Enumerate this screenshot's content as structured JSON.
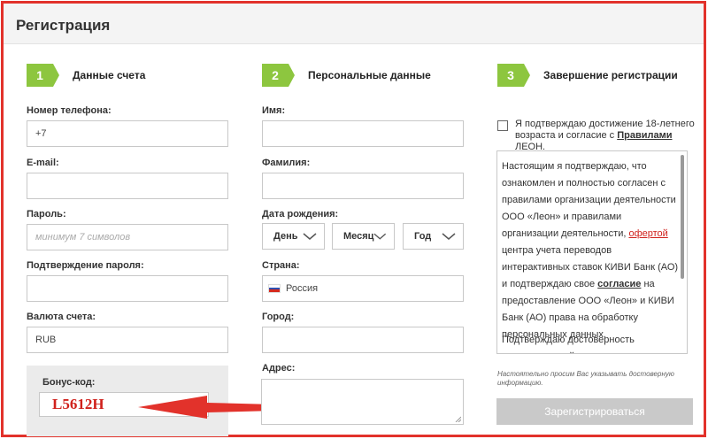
{
  "header": {
    "title": "Регистрация"
  },
  "steps": [
    {
      "num": "1",
      "title": "Данные счета"
    },
    {
      "num": "2",
      "title": "Персональные данные"
    },
    {
      "num": "3",
      "title": "Завершение регистрации"
    }
  ],
  "account": {
    "phone_label": "Номер телефона:",
    "phone_value": "+7",
    "email_label": "E-mail:",
    "email_value": "",
    "password_label": "Пароль:",
    "password_placeholder": "минимум 7 символов",
    "confirm_label": "Подтверждение пароля:",
    "confirm_value": "",
    "currency_label": "Валюта счета:",
    "currency_value": "RUB",
    "bonus_label": "Бонус-код:",
    "bonus_value": "L5612H"
  },
  "personal": {
    "name_label": "Имя:",
    "surname_label": "Фамилия:",
    "birth_label": "Дата рождения:",
    "day": "День",
    "month": "Месяц",
    "year": "Год",
    "country_label": "Страна:",
    "country_value": "Россия",
    "city_label": "Город:",
    "address_label": "Адрес:"
  },
  "finish": {
    "agree_text": "Я подтверждаю достижение 18-летнего возраста и согласие с",
    "agree_link": "Правилами",
    "agree_end": "ЛЕОН.",
    "terms_p1_a": "Настоящим я подтверждаю, что ознакомлен и полностью согласен с правилами организации деятельности ООО «Леон» и правилами организации деятельности,",
    "terms_p1_link1": "офертой",
    "terms_p1_b": "центра учета переводов интерактивных ставок КИВИ Банк (АО) и подтверждаю свое",
    "terms_p1_link2": "согласие",
    "terms_p1_c": "на предоставление ООО «Леон» и КИВИ Банк (АО) права на обработку персональных данных.",
    "terms_p2": "Подтверждаю достоверность указанных мной персональных данных",
    "notice": "Настоятельно просим Вас указывать достоверную информацию.",
    "submit_label": "Зарегистрироваться"
  },
  "colors": {
    "accent": "#8dc63f",
    "frame": "#e2322b",
    "bonus_text": "#d0211c",
    "button": "#c9c9c9"
  }
}
